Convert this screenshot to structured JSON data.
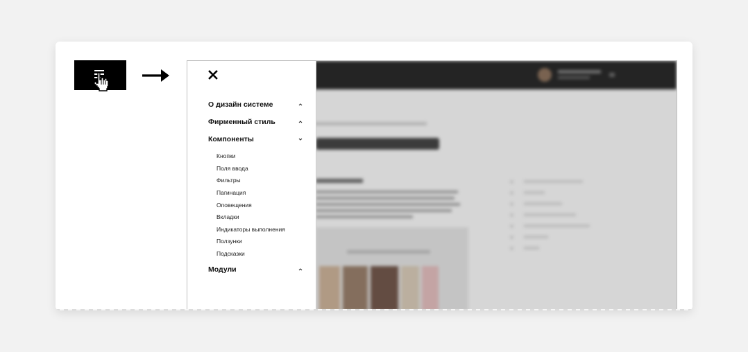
{
  "icons": {
    "hamburger": "hamburger-menu-icon",
    "cursor": "pointer-hand-icon",
    "arrow": "arrow-right-icon",
    "close": "close-icon",
    "chevron_up": "chevron-up-icon",
    "chevron_down": "chevron-down-icon"
  },
  "colors": {
    "page_background": "#f2f2f2",
    "button_background": "#000000",
    "menu_text": "#111111"
  },
  "menu": {
    "sections": [
      {
        "label": "О дизайн системе",
        "expanded": false
      },
      {
        "label": "Фирменный стиль",
        "expanded": false
      },
      {
        "label": "Компоненты",
        "expanded": true
      },
      {
        "label": "Модули",
        "expanded": false
      }
    ],
    "components_items": [
      "Кнопки",
      "Поля ввода",
      "Фильтры",
      "Пагинация",
      "Оповещения",
      "Вкладки",
      "Индикаторы выполнения",
      "Ползунки",
      "Подсказки"
    ]
  }
}
